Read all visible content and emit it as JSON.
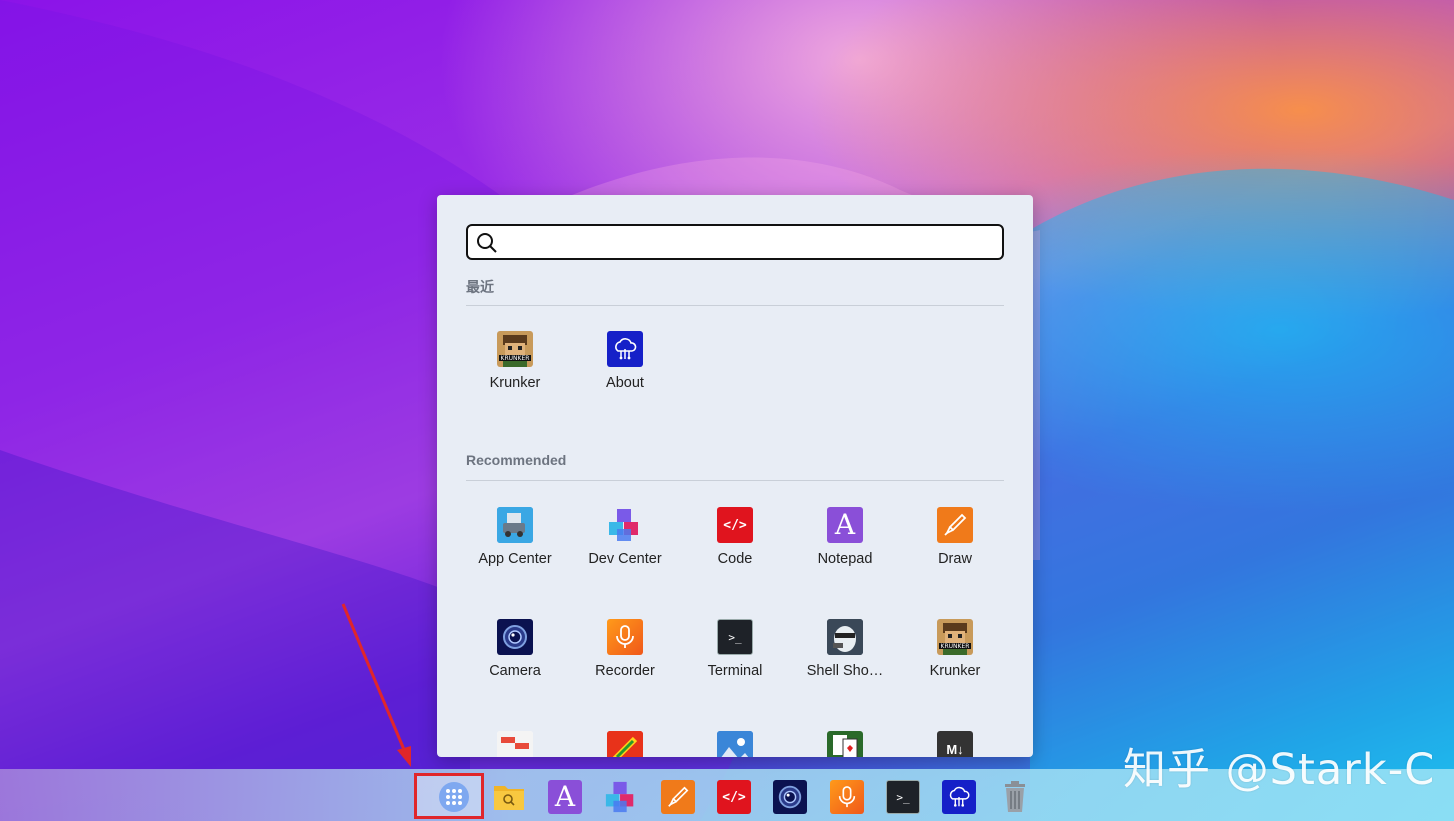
{
  "launcher": {
    "search_placeholder": "",
    "recent_title": "最近",
    "recommended_title": "Recommended",
    "recent": [
      {
        "label": "Krunker",
        "icon": "krunker-icon"
      },
      {
        "label": "About",
        "icon": "about-icon"
      }
    ],
    "recommended": [
      {
        "label": "App Center",
        "icon": "app-center-icon"
      },
      {
        "label": "Dev Center",
        "icon": "dev-center-icon"
      },
      {
        "label": "Code",
        "icon": "code-icon"
      },
      {
        "label": "Notepad",
        "icon": "notepad-icon"
      },
      {
        "label": "Draw",
        "icon": "draw-icon"
      },
      {
        "label": "Camera",
        "icon": "camera-icon"
      },
      {
        "label": "Recorder",
        "icon": "recorder-icon"
      },
      {
        "label": "Terminal",
        "icon": "terminal-icon"
      },
      {
        "label": "Shell Sho…",
        "icon": "shell-shockers-icon"
      },
      {
        "label": "Krunker",
        "icon": "krunker-icon"
      }
    ]
  },
  "taskbar": {
    "items": [
      "start-menu-icon",
      "file-manager-icon",
      "notepad-icon",
      "dev-center-icon",
      "draw-icon",
      "code-icon",
      "camera-icon",
      "recorder-icon",
      "terminal-icon",
      "about-icon",
      "trash-icon"
    ]
  },
  "watermark": "知乎 @Stark-C",
  "colors": {
    "accent_red": "#e0262b",
    "launcher_bg": "#e8edf5"
  }
}
